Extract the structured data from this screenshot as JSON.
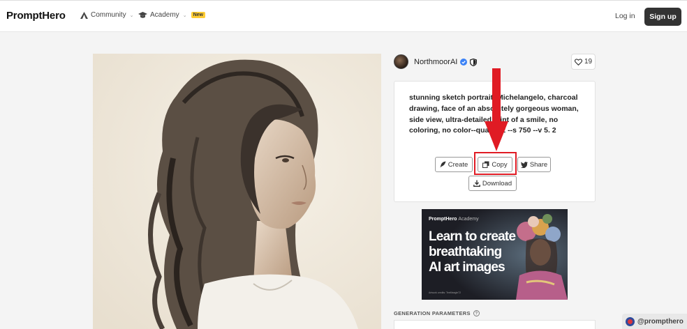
{
  "header": {
    "logo": "PromptHero",
    "nav": [
      {
        "label": "Community",
        "icon": "community-icon"
      },
      {
        "label": "Academy",
        "icon": "graduation-cap-icon",
        "badge": "New"
      }
    ],
    "login_label": "Log in",
    "signup_label": "Sign up"
  },
  "image": {
    "alt": "charcoal sketch portrait of a woman with long wavy hair"
  },
  "user": {
    "name": "NorthmoorAI",
    "like_count": "19"
  },
  "prompt": {
    "text": "stunning sketch portrait, Michelangelo, charcoal drawing, face of an absolutely gorgeous woman, side view, ultra-detailed, hint of a smile, no coloring, no color--quality 2 --s 750 --v 5. 2",
    "buttons": {
      "create": "Create",
      "copy": "Copy",
      "share": "Share",
      "download": "Download"
    }
  },
  "ad": {
    "brand": "PromptHero",
    "brand_suffix": "Academy",
    "headline_lines": [
      "Learn to create",
      "breathtaking",
      "AI art images"
    ],
    "credits": "Artwork credits: TeeMeagle72"
  },
  "sections": {
    "generation_parameters": "GENERATION PARAMETERS"
  },
  "watermark": "@prompthero",
  "colors": {
    "annotation_red": "#e01b24",
    "new_badge": "#ffcc33",
    "signup_bg": "#333333",
    "verified_blue": "#3b82f6"
  }
}
